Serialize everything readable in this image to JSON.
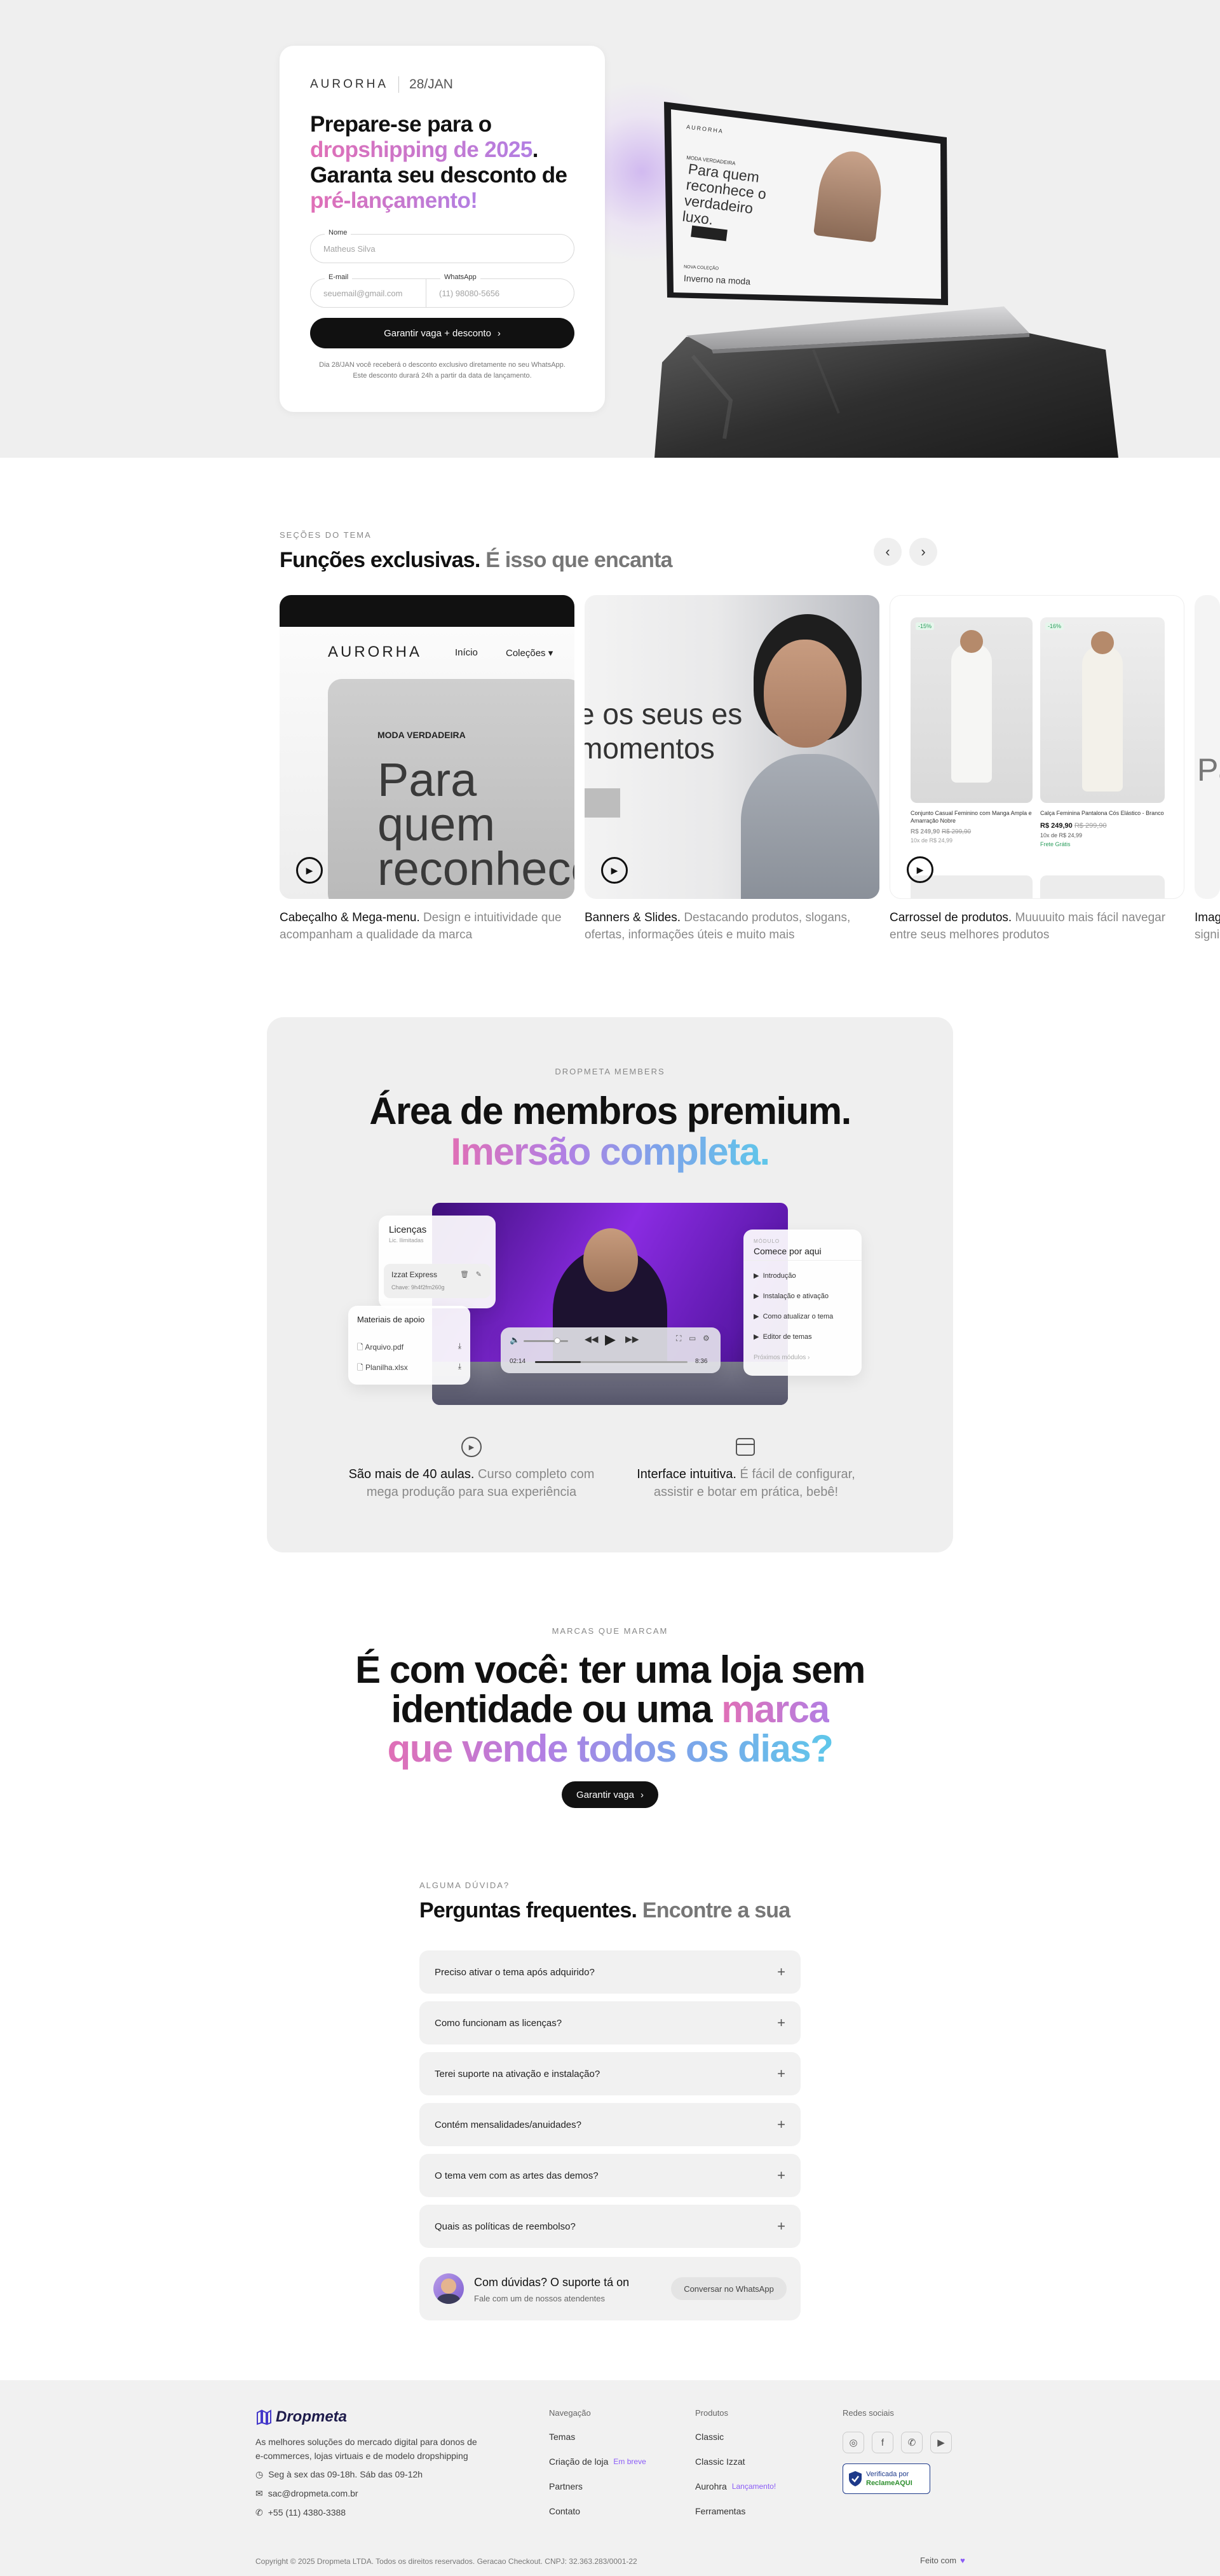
{
  "colors": {
    "accent_pink": "#e06fb6",
    "accent_purple": "#b27fe3",
    "accent_blue": "#5fc7ea",
    "dark": "#111111",
    "footer_bg": "#f1f1f1"
  },
  "hero": {
    "brand": "AURORHA",
    "date": "28/JAN",
    "title_l1": "Prepare-se para o",
    "title_l2_grad": "dropshipping de 2025",
    "title_l2_dot": ".",
    "title_l3": "Garanta seu desconto de",
    "title_l4_grad": "pré-lançamento!",
    "name_label": "Nome",
    "name_placeholder": "Matheus Silva",
    "email_label": "E-mail",
    "email_placeholder": "seuemail@gmail.com",
    "whatsapp_label": "WhatsApp",
    "whatsapp_placeholder": "(11) 98080-5656",
    "cta": "Garantir vaga + desconto",
    "note": "Dia 28/JAN você receberá o desconto exclusivo diretamente no seu WhatsApp. Este desconto durará 24h a partir da data de lançamento.",
    "laptop": {
      "brand": "AURORHA",
      "eyebrow": "MODA VERDADEIRA",
      "headline": "Para quem reconhece o verdadeiro luxo.",
      "sub_eyebrow": "NOVA COLEÇÃO",
      "sub_headline": "Inverno na moda"
    }
  },
  "features": {
    "eyebrow": "SEÇÕES DO TEMA",
    "title": "Funções exclusivas.",
    "title_muted": "É isso que encanta",
    "prev_icon": "chevron-left-icon",
    "next_icon": "chevron-right-icon",
    "cards": [
      {
        "brand": "AURORHA",
        "nav_home": "Início",
        "nav_collections": "Coleções",
        "eyebrow": "MODA VERDADEIRA",
        "headline": "Para quem reconhece o verdadeiro",
        "cap_strong": "Cabeçalho & Mega-menu.",
        "cap_muted": "Design e intuitividade que acompanham a qualidade da marca"
      },
      {
        "headline": "e os seus es momentos",
        "cap_strong": "Banners & Slides.",
        "cap_muted": "Destacando produtos, slogans, ofertas, informações úteis e muito mais"
      },
      {
        "p1_badge": "-15%",
        "p1_name": "Conjunto Casual Feminino com Manga Ampla e Amarração Nobre",
        "p1_price": "R$ 249,90",
        "p1_old": "R$ 299,90",
        "p1_installments": "10x de R$ 24,99",
        "p2_badge": "-16%",
        "p2_name": "Calça Feminina Pantalona Cós Elástico - Branco",
        "p2_price": "R$ 249,90",
        "p2_old": "R$ 299,90",
        "p2_installments": "10x de R$ 24,99",
        "p2_shipping": "Frete Grátis",
        "cap_strong": "Carrossel de produtos.",
        "cap_muted": "Muuuuito mais fácil navegar entre seus melhores produtos"
      },
      {
        "headline": "Pa",
        "cap_strong": "Imag",
        "cap_muted": "signi"
      }
    ]
  },
  "members": {
    "eyebrow": "DROPMETA MEMBERS",
    "title_l1": "Área de membros premium.",
    "title_l2": "Imersão completa.",
    "licenses_title": "Licenças",
    "licenses_sub": "Lic. Ilimitadas",
    "license_store": "Izzat Express",
    "license_key": "Chave: 9h4f2fm260g",
    "materials_title": "Materiais de apoio",
    "file1": "Arquivo.pdf",
    "file2": "Planilha.xlsx",
    "player_time_start": "02:14",
    "player_time_end": "8:36",
    "player_progress": 0.3,
    "module_eyebrow": "MÓDULO",
    "module_title": "Comece por aqui",
    "lessons": [
      "Introdução",
      "Instalação e ativação",
      "Como atualizar o tema",
      "Editor de temas"
    ],
    "next_modules": "Próximos módulos",
    "f1_strong": "São mais de 40 aulas.",
    "f1_muted": "Curso completo com mega produção para sua experiência",
    "f2_strong": "Interface intuitiva.",
    "f2_muted": "É fácil de configurar, assistir e botar em prática, bebê!"
  },
  "brands": {
    "eyebrow": "MARCAS QUE MARCAM",
    "l1": "É com você: ter uma loja sem",
    "l2_a": "identidade ou uma",
    "l2_b": "marca",
    "l3": "que vende todos os dias?",
    "cta": "Garantir vaga"
  },
  "faq": {
    "eyebrow": "ALGUMA DÚVIDA?",
    "title": "Perguntas frequentes.",
    "title_muted": "Encontre a sua",
    "items": [
      "Preciso ativar o tema após adquirido?",
      "Como funcionam as licenças?",
      "Terei suporte na ativação e instalação?",
      "Contém mensalidades/anuidades?",
      "O tema vem com as artes das demos?",
      "Quais as políticas de reembolso?"
    ],
    "support_title": "Com dúvidas? O suporte tá on",
    "support_sub": "Fale com um de nossos atendentes",
    "support_btn": "Conversar no WhatsApp"
  },
  "footer": {
    "logo": "Dropmeta",
    "tagline": "As melhores soluções do mercado digital para donos de e-commerces, lojas virtuais e de modelo dropshipping",
    "hours": "Seg à sex das 09-18h. Sáb das 09-12h",
    "email": "sac@dropmeta.com.br",
    "phone": "+55 (11) 4380-3388",
    "nav_head": "Navegação",
    "nav": [
      "Temas",
      "Criação de loja",
      "Partners",
      "Contato"
    ],
    "nav_tag": "Em breve",
    "products_head": "Produtos",
    "products": [
      "Classic",
      "Classic Izzat",
      "Aurohra",
      "Ferramentas"
    ],
    "products_tag": "Lançamento!",
    "social_head": "Redes sociais",
    "reclame_verified": "Verificada por",
    "reclame_name": "ReclameAQUI",
    "copyright": "Copyright © 2025 Dropmeta LTDA. Todos os direitos reservados. Geracao Checkout. CNPJ: 32.363.283/0001-22",
    "made_with": "Feito com"
  }
}
